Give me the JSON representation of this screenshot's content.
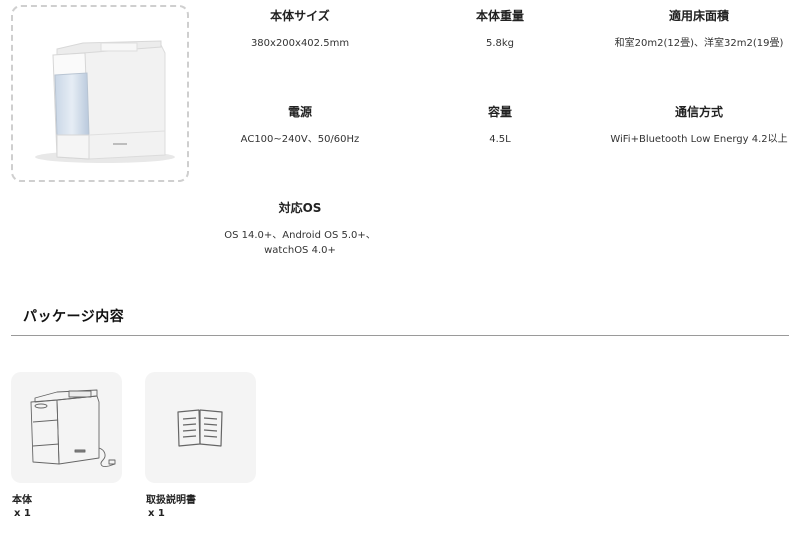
{
  "specs": [
    {
      "label": "本体サイズ",
      "value": "380x200x402.5mm"
    },
    {
      "label": "本体重量",
      "value": "5.8kg"
    },
    {
      "label": "適用床面積",
      "value": "和室20m2(12畳)、洋室32m2(19畳)"
    },
    {
      "label": "電源",
      "value": "AC100~240V、50/60Hz"
    },
    {
      "label": "容量",
      "value": "4.5L"
    },
    {
      "label": "通信方式",
      "value": "WiFi+Bluetooth Low Energy 4.2以上"
    },
    {
      "label": "対応OS",
      "value": "OS 14.0+、Android OS 5.0+、",
      "value2": "watchOS 4.0+"
    }
  ],
  "package": {
    "title": "パッケージ内容",
    "items": [
      {
        "name": "本体",
        "qty": "x 1",
        "icon": "humidifier-outline-icon"
      },
      {
        "name": "取扱説明書",
        "qty": "x 1",
        "icon": "manual-book-icon"
      }
    ]
  }
}
